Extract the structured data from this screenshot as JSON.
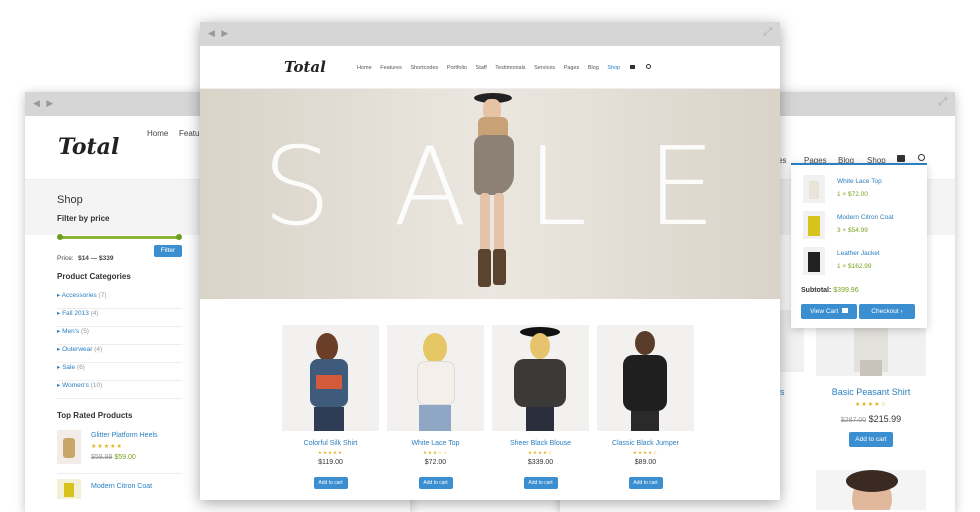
{
  "back_window": {
    "logo": "Total",
    "nav": [
      "Home",
      "Featu"
    ],
    "page_title": "Shop",
    "filter": {
      "heading": "Filter by price",
      "price_label": "Price:",
      "price_range": "$14 — $339",
      "button": "Filter"
    },
    "categories_heading": "Product Categories",
    "categories": [
      {
        "name": "Accessories",
        "count": "(7)"
      },
      {
        "name": "Fall 2013",
        "count": "(4)"
      },
      {
        "name": "Men's",
        "count": "(5)"
      },
      {
        "name": "Outerwear",
        "count": "(4)"
      },
      {
        "name": "Sale",
        "count": "(6)"
      },
      {
        "name": "Women's",
        "count": "(10)"
      }
    ],
    "top_rated_heading": "Top Rated Products",
    "top_rated": [
      {
        "name": "Glitter Platform Heels",
        "stars": "★★★★★",
        "old_price": "$59.99",
        "price": "$59.00"
      },
      {
        "name": "Modern Citron Coat"
      }
    ]
  },
  "right_window": {
    "nav": [
      "ces",
      "Pages",
      "Blog",
      "Shop"
    ],
    "cart_items": [
      {
        "name": "White Lace Top",
        "qty": "1 × $72.00"
      },
      {
        "name": "Modern Citron Coat",
        "qty": "3 × $54.99"
      },
      {
        "name": "Leather Jacket",
        "qty": "1 × $162.99"
      }
    ],
    "subtotal_label": "Subtotal:",
    "subtotal_value": "$399.96",
    "view_cart": "View Cart",
    "checkout": "Checkout",
    "partial_product_fragment": "s",
    "product": {
      "name": "Basic Peasant Shirt",
      "stars": "★★★★☆",
      "old_price": "$287.00",
      "price": "$215.99",
      "button": "Add to cart"
    }
  },
  "front_window": {
    "logo": "Total",
    "nav": [
      "Home",
      "Features",
      "Shortcodes",
      "Portfolio",
      "Staff",
      "Testimonials",
      "Services",
      "Pages",
      "Blog",
      "Shop"
    ],
    "active_nav": "Shop",
    "hero_text": "SALE",
    "products": [
      {
        "name": "Colorful Silk Shirt",
        "stars": "★★★★★",
        "price": "$119.00",
        "button": "Add to cart",
        "color": "#d45a3c"
      },
      {
        "name": "White Lace Top",
        "stars": "★★★☆☆",
        "price": "$72.00",
        "button": "Add to cart",
        "color": "#f4efe9"
      },
      {
        "name": "Sheer Black Blouse",
        "stars": "★★★★☆",
        "price": "$339.00",
        "button": "Add to cart",
        "color": "#3c3a38"
      },
      {
        "name": "Classic Black Jumper",
        "stars": "★★★★☆",
        "price": "$89.00",
        "button": "Add to cart",
        "color": "#1f1f1f"
      }
    ]
  },
  "icons": {
    "back": "◀",
    "forward": "▶",
    "expand": "⤢",
    "cart": "🛒",
    "search": "⚲",
    "chevron": "›",
    "bullet": "▸"
  }
}
